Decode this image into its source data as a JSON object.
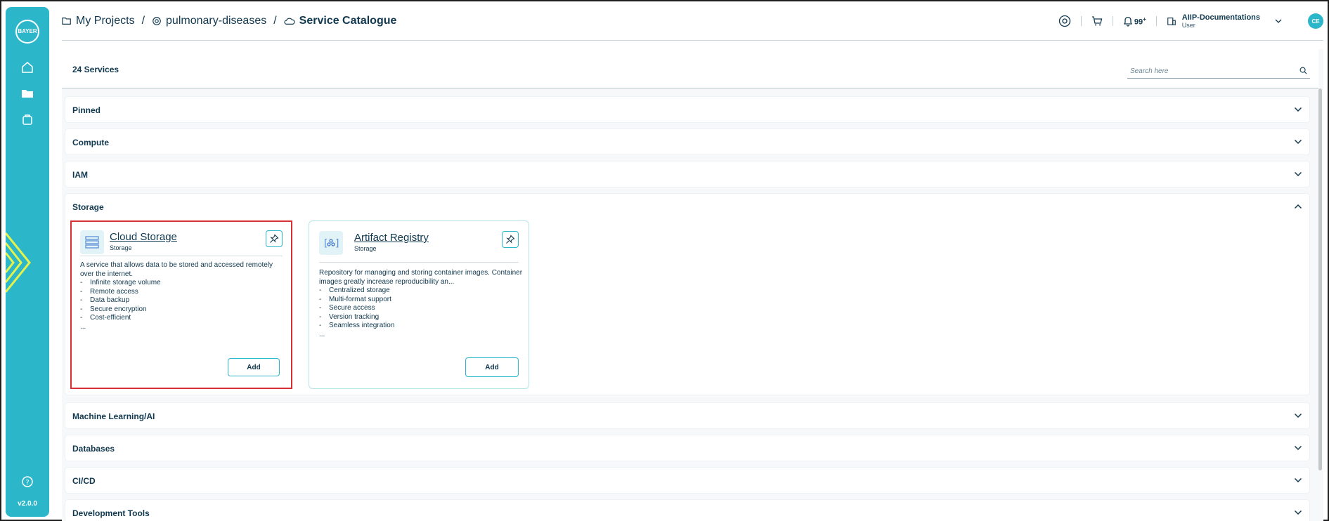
{
  "sidebar": {
    "logo_text": "BAYER",
    "version": "v2.0.0"
  },
  "breadcrumb": {
    "items": [
      "My Projects",
      "pulmonary-diseases",
      "Service Catalogue"
    ],
    "separator": "/"
  },
  "header": {
    "notifications": "99",
    "notifications_sup": "+",
    "user_name": "AIIP-Documentations",
    "user_role": "User",
    "avatar_initials": "CE"
  },
  "catalogue": {
    "count_label": "24 Services",
    "search_placeholder": "Search here",
    "categories": [
      "Pinned",
      "Compute",
      "IAM",
      "Storage",
      "Machine Learning/AI",
      "Databases",
      "CI/CD",
      "Development Tools"
    ],
    "cards": [
      {
        "title": "Cloud Storage",
        "subtitle": "Storage",
        "desc": "A service that allows data to be stored and accessed remotely over the internet.",
        "bullets": [
          "Infinite storage volume",
          "Remote access",
          "Data backup",
          "Secure encryption",
          "Cost-efficient"
        ],
        "ellipsis": "...",
        "add_label": "Add"
      },
      {
        "title": "Artifact Registry",
        "subtitle": "Storage",
        "desc": "Repository for managing and storing container images. Container images greatly increase reproducibility an...",
        "bullets": [
          "Centralized storage",
          "Multi-format support",
          "Secure access",
          "Version tracking",
          "Seamless integration"
        ],
        "ellipsis": "...",
        "add_label": "Add"
      }
    ]
  },
  "colors": {
    "accent": "#2bb6c9",
    "text": "#10384f",
    "highlight": "#d93036"
  }
}
